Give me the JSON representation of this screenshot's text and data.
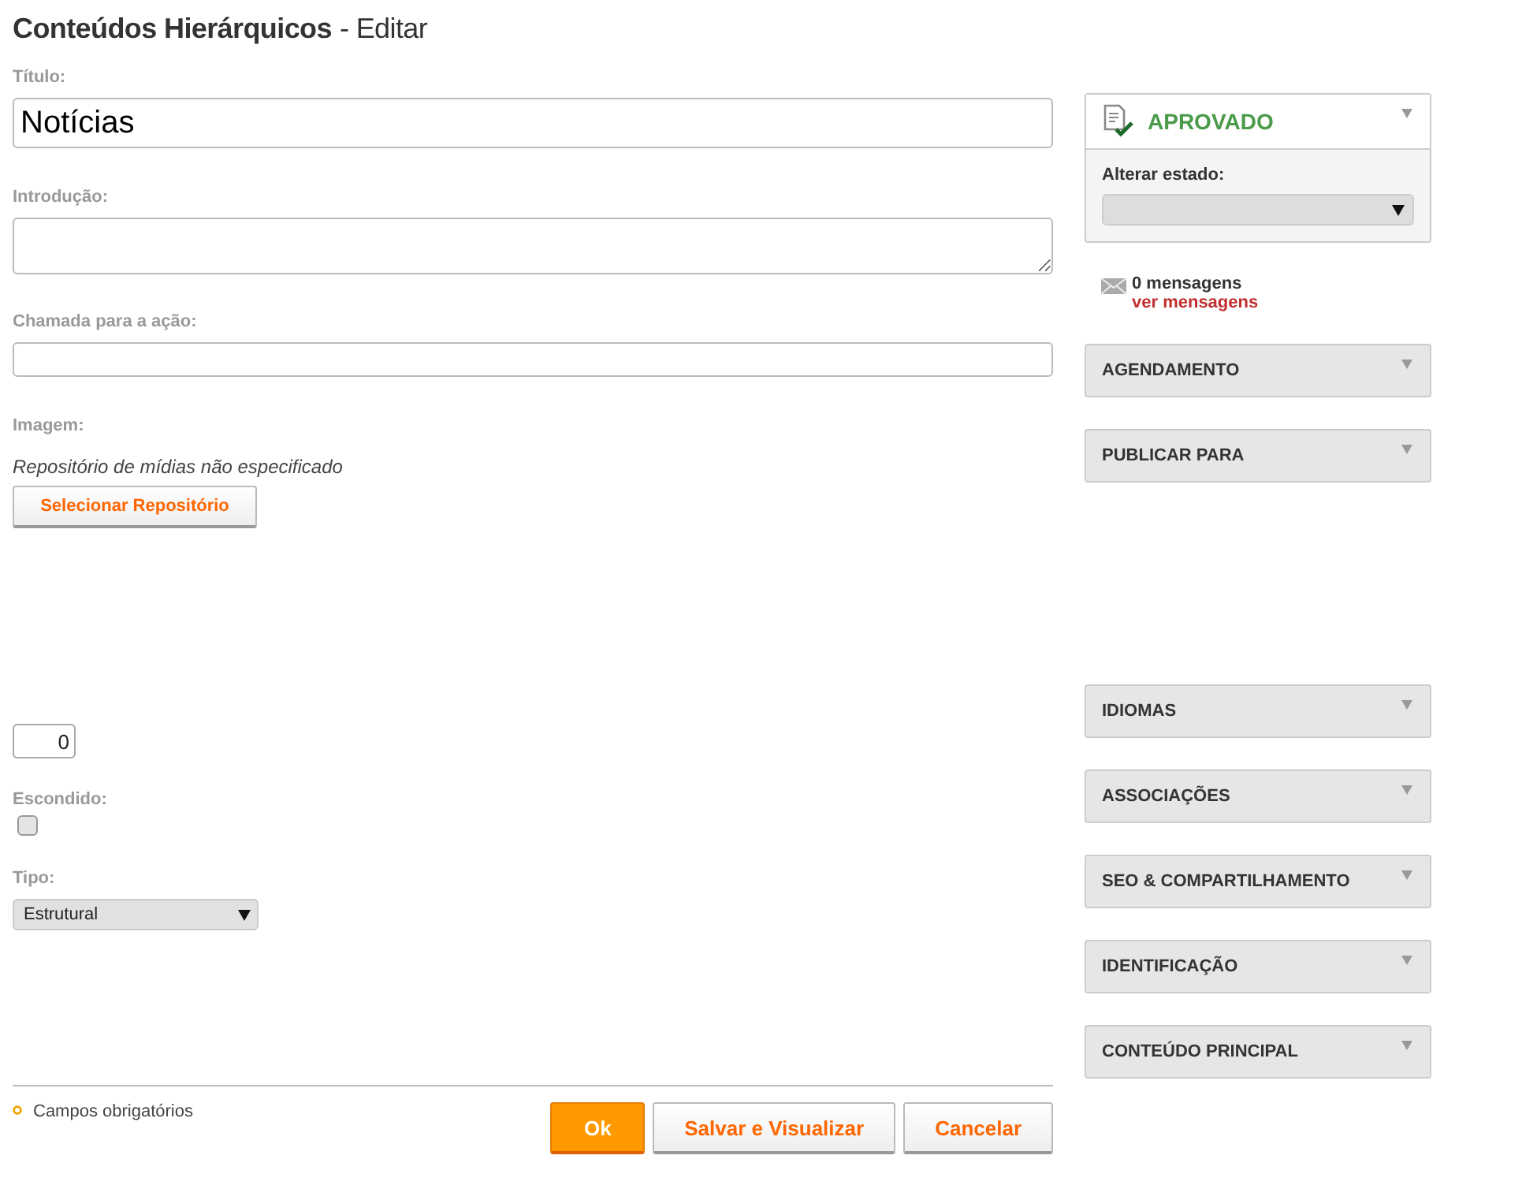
{
  "page_title": {
    "main": "Conteúdos Hierárquicos",
    "suffix": "- Editar"
  },
  "form": {
    "fields": [
      {
        "kind": "large_text",
        "label": "Título:",
        "value": "Notícias"
      },
      {
        "kind": "textarea",
        "label": "Introdução:"
      },
      {
        "kind": "text",
        "label": "Chamada para a ação:"
      },
      {
        "kind": "image",
        "label": "Imagem:",
        "note": "Repositório de mídias não especificado",
        "button": "Selecionar Repositório"
      },
      {
        "kind": "number",
        "value": "0"
      },
      {
        "kind": "checkbox",
        "label": "Escondido:",
        "checked": false
      },
      {
        "kind": "select",
        "label": "Tipo:",
        "value": "Estrutural"
      }
    ]
  },
  "footer": {
    "required_note": "Campos obrigatórios",
    "buttons": [
      {
        "label": "Ok",
        "primary": true
      },
      {
        "label": "Salvar e Visualizar",
        "primary": false
      },
      {
        "label": "Cancelar",
        "primary": false
      }
    ]
  },
  "status_panel": {
    "status": "APROVADO",
    "change_label": "Alterar estado:"
  },
  "messages": {
    "count": "0 mensagens",
    "link": "ver mensagens"
  },
  "panel_groups": [
    [
      "AGENDAMENTO",
      "PUBLICAR PARA"
    ],
    [
      "IDIOMAS",
      "ASSOCIAÇÕES",
      "SEO & COMPARTILHAMENTO",
      "IDENTIFICAÇÃO",
      "CONTEÚDO PRINCIPAL"
    ]
  ]
}
